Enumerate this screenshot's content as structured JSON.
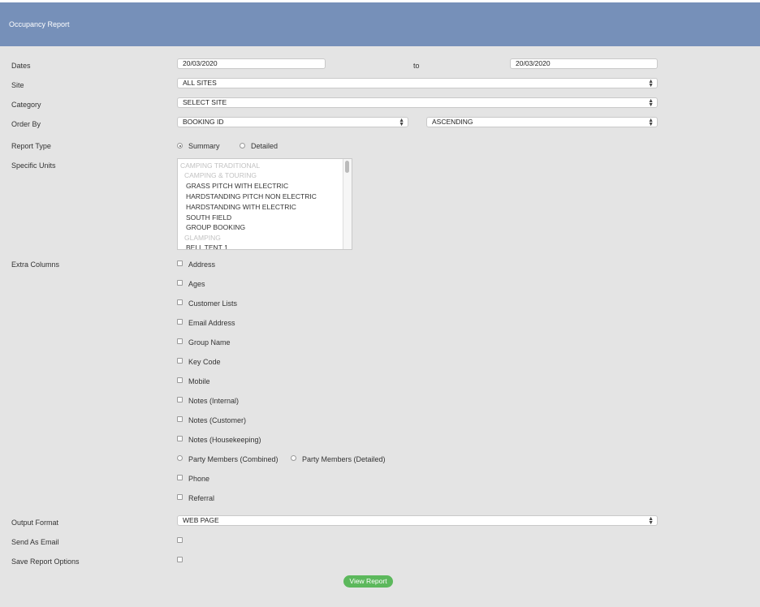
{
  "header": {
    "title": "Occupancy Report"
  },
  "labels": {
    "dates": "Dates",
    "site": "Site",
    "category": "Category",
    "order_by": "Order By",
    "report_type": "Report Type",
    "specific_units": "Specific Units",
    "extra_columns": "Extra Columns",
    "output_format": "Output Format",
    "send_as_email": "Send As Email",
    "save_report_options": "Save Report Options"
  },
  "dates": {
    "from": "20/03/2020",
    "to_label": "to",
    "to": "20/03/2020"
  },
  "site": {
    "selected": "ALL SITES"
  },
  "category": {
    "selected": "SELECT SITE"
  },
  "order_by": {
    "field": "BOOKING ID",
    "direction": "ASCENDING"
  },
  "report_type": {
    "options": [
      "Summary",
      "Detailed"
    ],
    "selected": "Summary"
  },
  "specific_units": {
    "items": [
      {
        "text": "CAMPING TRADITIONAL",
        "group": true
      },
      {
        "text": "CAMPING & TOURING",
        "group": true
      },
      {
        "text": "GRASS PITCH WITH ELECTRIC",
        "group": false
      },
      {
        "text": "HARDSTANDING PITCH NON ELECTRIC",
        "group": false
      },
      {
        "text": "HARDSTANDING WITH ELECTRIC",
        "group": false
      },
      {
        "text": "SOUTH FIELD",
        "group": false
      },
      {
        "text": "GROUP BOOKING",
        "group": false
      },
      {
        "text": "GLAMPING",
        "group": true
      },
      {
        "text": "BELL TENT 1",
        "group": false
      }
    ]
  },
  "extra_columns": {
    "address": "Address",
    "ages": "Ages",
    "customer_lists": "Customer Lists",
    "email_address": "Email Address",
    "group_name": "Group Name",
    "key_code": "Key Code",
    "mobile": "Mobile",
    "notes_internal": "Notes (Internal)",
    "notes_customer": "Notes (Customer)",
    "notes_housekeeping": "Notes (Housekeeping)",
    "party_members_combined": "Party Members (Combined)",
    "party_members_detailed": "Party Members (Detailed)",
    "phone": "Phone",
    "referral": "Referral"
  },
  "output_format": {
    "selected": "WEB PAGE"
  },
  "buttons": {
    "view_report": "View Report"
  }
}
